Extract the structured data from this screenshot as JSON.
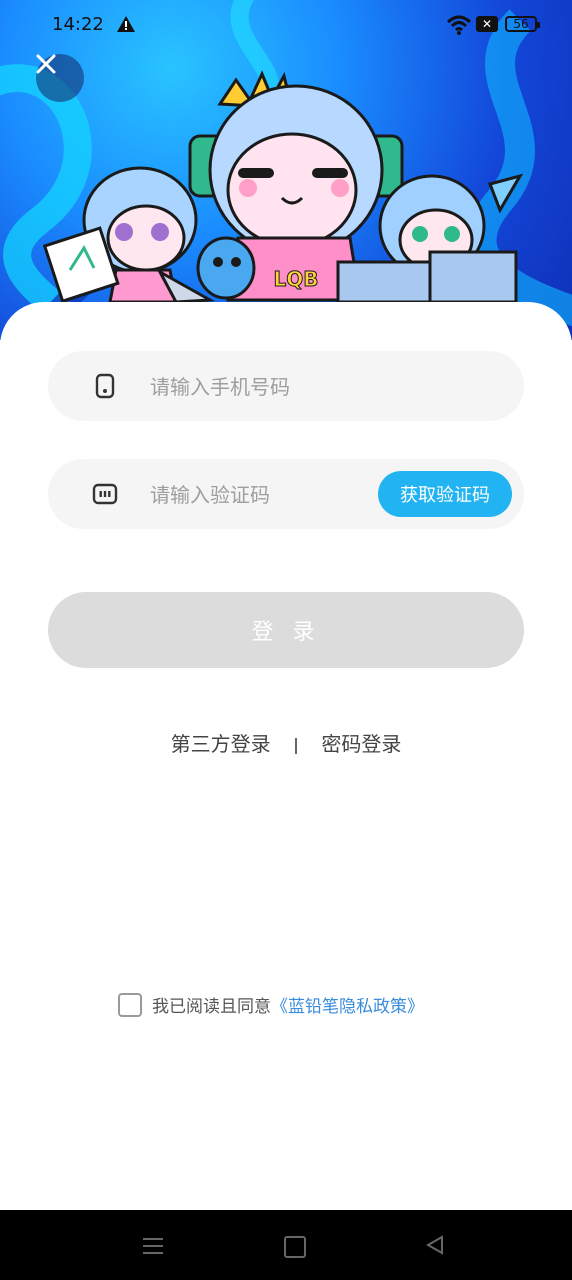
{
  "status_bar": {
    "time": "14:22",
    "sim_icon": "sim-off-icon",
    "battery": "56"
  },
  "hero": {
    "mascot_badge": "LQB"
  },
  "form": {
    "phone_placeholder": "请输入手机号码",
    "code_placeholder": "请输入验证码",
    "get_code_label": "获取验证码",
    "login_label": "登 录"
  },
  "alt_login": {
    "third_party": "第三方登录",
    "password": "密码登录"
  },
  "agreement": {
    "text": "我已阅读且同意",
    "link": "《蓝铅笔隐私政策》",
    "checked": false
  },
  "colors": {
    "accent": "#22b4f2",
    "link": "#3a8cdc",
    "login_disabled": "#dcdcdc"
  }
}
